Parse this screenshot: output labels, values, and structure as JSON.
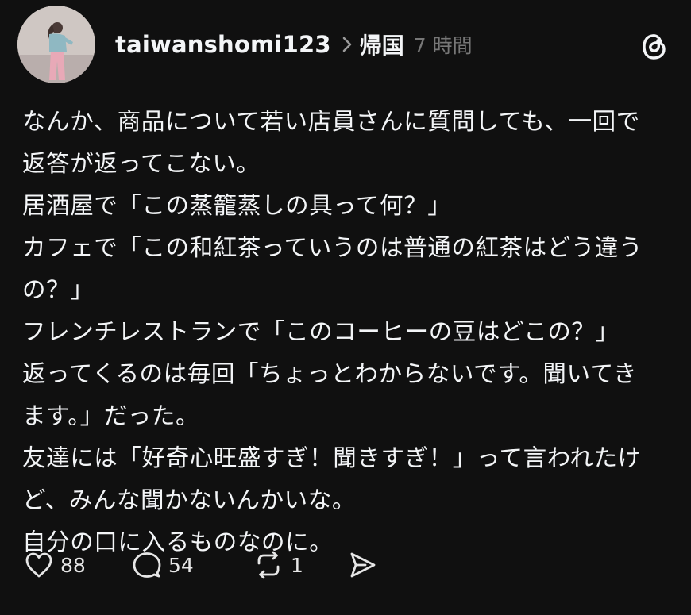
{
  "post": {
    "author": {
      "username": "taiwanshomi123",
      "avatar_icon": "avatar-photo"
    },
    "topic": "帰国",
    "time": "7 時間",
    "app_icon": "threads-logo-icon",
    "lines": [
      "なんか、商品について若い店員さんに質問しても、一回で",
      "返答が返ってこない。",
      "居酒屋で「この蒸籠蒸しの具って何？」",
      "カフェで「この和紅茶っていうのは普通の紅茶はどう違う",
      "の？」",
      "フレンチレストランで「このコーヒーの豆はどこの？」",
      "返ってくるのは毎回「ちょっとわからないです。聞いてき",
      "ます。」だった。",
      "友達には「好奇心旺盛すぎ！聞きすぎ！」って言われたけ",
      "ど、みんな聞かないんかいな。",
      "自分の口に入るものなのに。"
    ],
    "actions": {
      "like": {
        "icon": "heart-icon",
        "count": "88"
      },
      "reply": {
        "icon": "comment-icon",
        "count": "54"
      },
      "repost": {
        "icon": "repost-icon",
        "count": "1"
      },
      "share": {
        "icon": "send-icon"
      }
    }
  },
  "colors": {
    "background": "#101010",
    "text": "#f3f5f7",
    "muted": "#777777"
  }
}
